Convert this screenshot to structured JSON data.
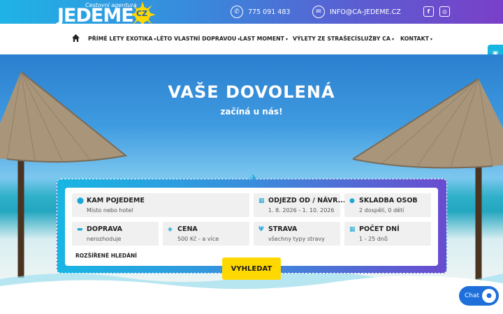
{
  "header": {
    "logo_subtitle": "Cestovní agentura",
    "logo_name": "JEDEME",
    "logo_tld": "CZ",
    "phone": "775 091 483",
    "email": "INFO@CA-JEDEME.CZ",
    "social": [
      "facebook-icon",
      "instagram-icon"
    ]
  },
  "nav": {
    "items": [
      {
        "label": "PŘÍMÉ LETY EXOTIKA",
        "dropdown": true
      },
      {
        "label": "LÉTO VLASTNÍ DOPRAVOU",
        "dropdown": true
      },
      {
        "label": "LAST MOMENT",
        "dropdown": true
      },
      {
        "label": "VÝLETY ZE STRAŠECÍ",
        "dropdown": false
      },
      {
        "label": "SLUŽBY CA",
        "dropdown": true
      },
      {
        "label": "KONTAKT",
        "dropdown": true
      }
    ]
  },
  "hero": {
    "title": "VAŠE DOVOLENÁ",
    "subtitle": "začíná u nás!"
  },
  "search": {
    "fields": [
      {
        "label": "KAM POJEDEME",
        "value": "Místo nebo hotel",
        "icon": "map-pin-icon"
      },
      {
        "label": "ODJEZD OD / NÁVR...",
        "value": "1. 8. 2026 - 1. 10. 2026",
        "icon": "calendar-icon"
      },
      {
        "label": "SKLADBA OSOB",
        "value": "2 dospělí, 0 dětí",
        "icon": "person-icon"
      },
      {
        "label": "DOPRAVA",
        "value": "nerozhoduje",
        "icon": "car-icon"
      },
      {
        "label": "CENA",
        "value": "500 Kč - a více",
        "icon": "money-icon"
      },
      {
        "label": "STRAVA",
        "value": "všechny typy stravy",
        "icon": "cutlery-icon"
      },
      {
        "label": "POČET DNÍ",
        "value": "1 - 25 dnů",
        "icon": "calendar-days-icon"
      }
    ],
    "advanced_label": "ROZŠÍŘENÉ HLEDÁNÍ",
    "submit_label": "VYHLEDAT"
  },
  "chat": {
    "label": "Chat"
  },
  "colors": {
    "accent": "#1aa7d8",
    "button": "#ffd800",
    "chat": "#1e6fd9"
  }
}
